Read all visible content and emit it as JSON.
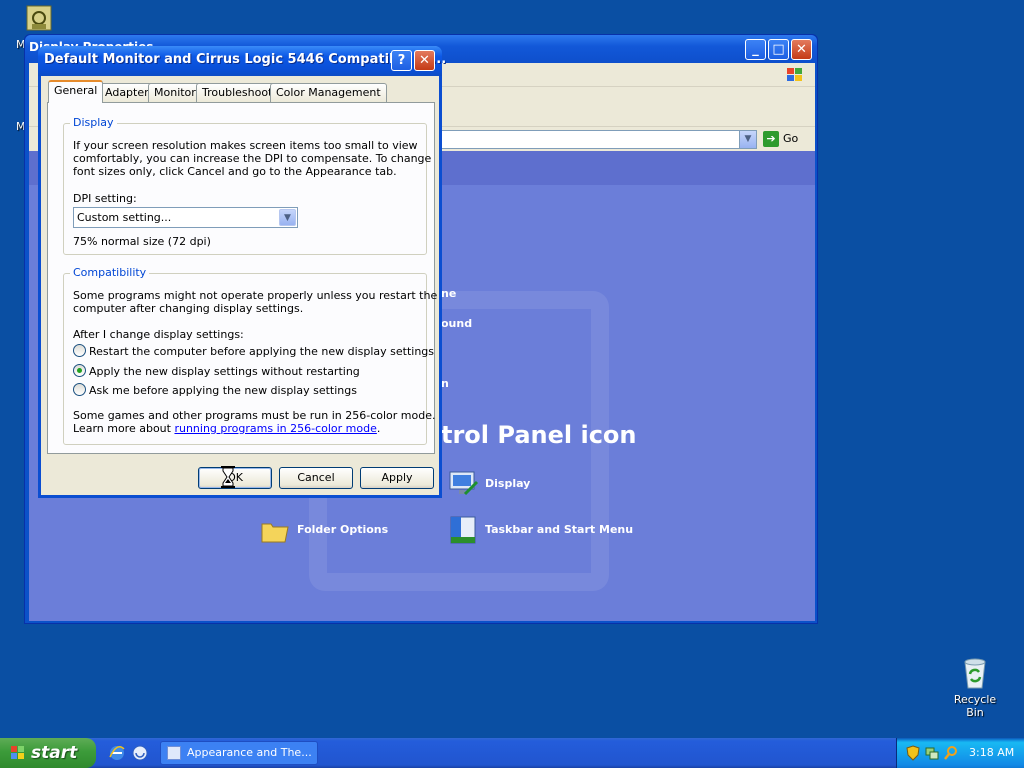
{
  "desktop": {
    "top_icon_label": "M",
    "recycle_bin_label": "Recycle Bin",
    "left_fragment_labels": [
      "M",
      "M"
    ]
  },
  "control_panel": {
    "title": "Display Properties",
    "go_label": "Go",
    "heading_fragment": "trol Panel icon",
    "left_fragments": [
      "ne",
      "ound",
      "n"
    ],
    "tasks": [
      {
        "label": "Display",
        "icon": "display-icon"
      },
      {
        "label": "Folder Options",
        "icon": "folder-options-icon"
      },
      {
        "label": "Taskbar and Start Menu",
        "icon": "taskbar-icon"
      }
    ]
  },
  "dialog": {
    "title": "Default Monitor and Cirrus Logic 5446 Compatible Gr...",
    "tabs": [
      "General",
      "Adapter",
      "Monitor",
      "Troubleshoot",
      "Color Management"
    ],
    "active_tab": "General",
    "display_group": {
      "title": "Display",
      "description": [
        "If your screen resolution makes screen items too small to view",
        "comfortably, you can increase the DPI to compensate.  To change",
        "font sizes only, click Cancel and go to the Appearance tab."
      ],
      "dpi_label": "DPI setting:",
      "dpi_value": "Custom setting...",
      "dpi_note": "75% normal size (72 dpi)"
    },
    "compat_group": {
      "title": "Compatibility",
      "description": [
        "Some programs might not operate properly unless you restart the",
        "computer after changing display settings."
      ],
      "after_label": "After I change display settings:",
      "options": [
        {
          "label": "Restart the computer before applying the new display settings",
          "selected": false
        },
        {
          "label": "Apply the new display settings without restarting",
          "selected": true
        },
        {
          "label": "Ask me before applying the new display settings",
          "selected": false
        }
      ],
      "footer_line1": "Some games and other programs must be run in 256-color mode.",
      "footer_learn": "Learn more about ",
      "footer_link": "running programs in 256-color mode",
      "footer_end": "."
    },
    "buttons": {
      "ok": "OK",
      "cancel": "Cancel",
      "apply": "Apply"
    }
  },
  "taskbar": {
    "start_label": "start",
    "task_button": "Appearance and The...",
    "clock": "3:18 AM"
  },
  "colors": {
    "desktop": "#0a4fa3",
    "title_bar": "#0c58e6",
    "dialog_face": "#ece9d8",
    "start_green": "#3c9b3a",
    "group_title": "#0046d5"
  }
}
